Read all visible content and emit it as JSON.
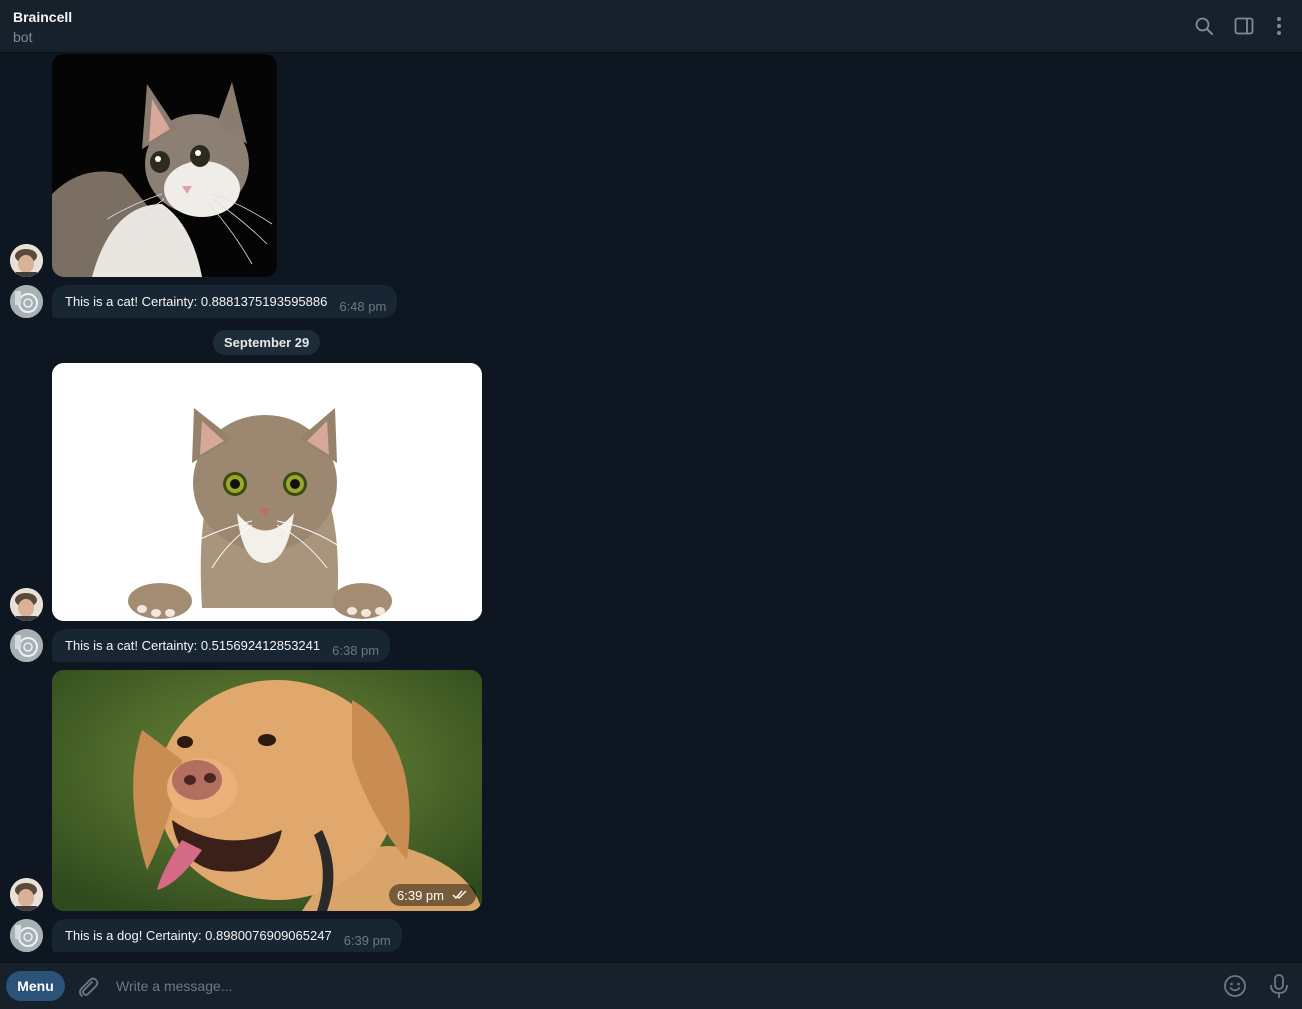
{
  "header": {
    "title": "Braincell",
    "subtitle": "bot",
    "icons": [
      "search-icon",
      "sidebar-toggle-icon",
      "more-vertical-icon"
    ]
  },
  "messages": [
    {
      "from": "user",
      "type": "photo",
      "photo": "cat-on-black-background"
    },
    {
      "from": "bot",
      "type": "text",
      "text": "This is a cat! Certainty: 0.8881375193595886",
      "time": "6:48 pm"
    },
    {
      "type": "date",
      "text": "September 29"
    },
    {
      "from": "user",
      "type": "photo",
      "photo": "cat-peeking-white-background"
    },
    {
      "from": "bot",
      "type": "text",
      "text": "This is a cat! Certainty: 0.515692412853241",
      "time": "6:38 pm"
    },
    {
      "from": "user",
      "type": "photo",
      "photo": "golden-retriever-dog",
      "time": "6:39 pm",
      "status": "read-double-check-icon"
    },
    {
      "from": "bot",
      "type": "text",
      "text": "This is a dog! Certainty: 0.8980076909065247",
      "time": "6:39 pm"
    }
  ],
  "composer": {
    "menu_label": "Menu",
    "placeholder": "Write a message...",
    "icons": [
      "attach-icon",
      "emoji-icon",
      "microphone-icon"
    ]
  },
  "colors": {
    "background": "#0e1621",
    "header": "#17212b",
    "bubble": "#182533",
    "accent": "#2b5278",
    "muted_text": "#6c7883"
  }
}
